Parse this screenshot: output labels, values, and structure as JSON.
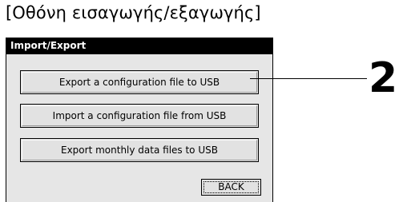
{
  "caption": "[Οθόνη εισαγωγής/εξαγωγής]",
  "window": {
    "title": "Import/Export"
  },
  "buttons": [
    {
      "label": "Export a configuration file to USB"
    },
    {
      "label": "Import a configuration file from USB"
    },
    {
      "label": "Export monthly data files to USB"
    }
  ],
  "back_button": {
    "label": "BACK"
  },
  "callout": {
    "number": "2"
  }
}
